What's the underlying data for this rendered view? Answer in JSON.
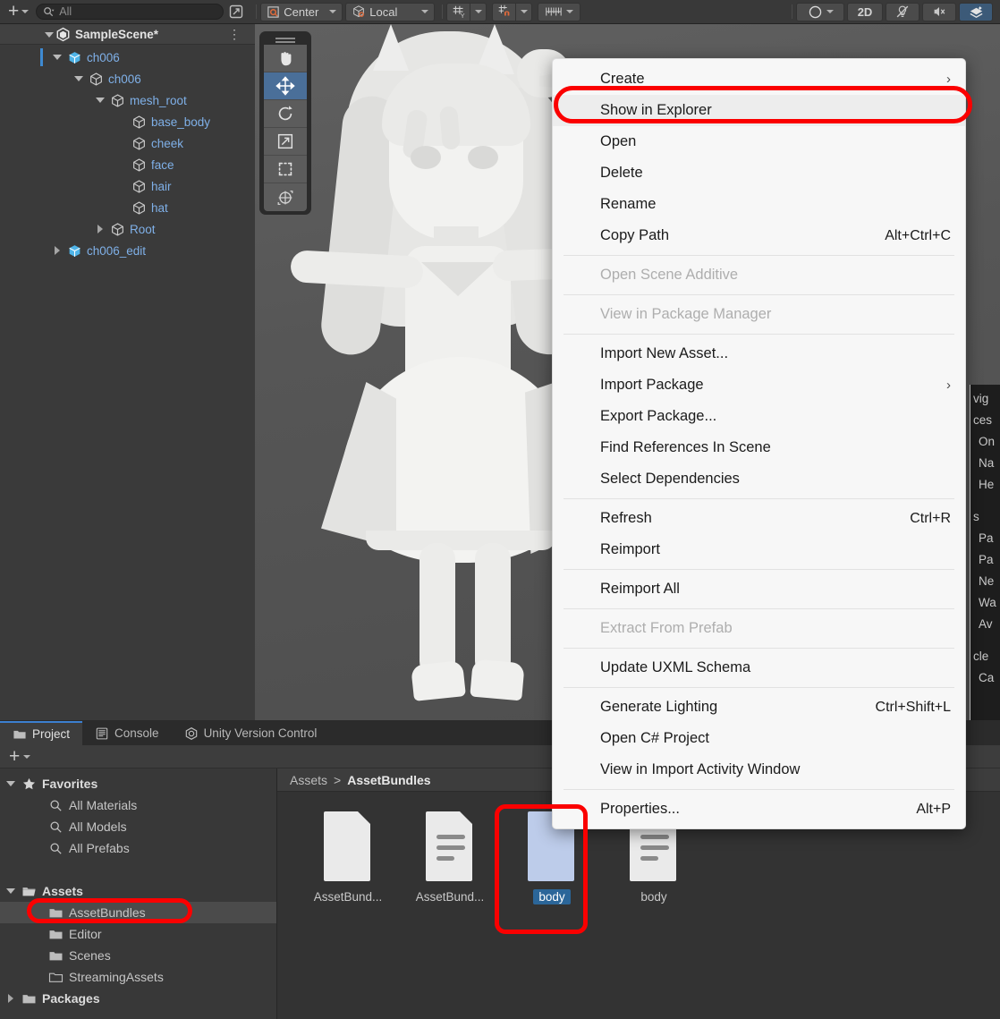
{
  "app": "Unity Editor",
  "toolbar": {
    "add_label": "+",
    "search_placeholder": "All",
    "search_value": "",
    "pivot_mode": "Center",
    "handle_space": "Local",
    "grid_axis": "Y",
    "snap_label": "snap",
    "ruler_label": "ruler",
    "shading_label": "shading",
    "mode_2d": "2D",
    "lighting_label": "lighting-off",
    "audio_label": "audio-off",
    "fx_label": "effects"
  },
  "hierarchy": {
    "scene_name": "SampleScene*",
    "items": [
      {
        "label": "ch006",
        "depth": 1,
        "expanded": true,
        "icon": "prefab",
        "selected": true
      },
      {
        "label": "ch006",
        "depth": 2,
        "expanded": true,
        "icon": "gameobject"
      },
      {
        "label": "mesh_root",
        "depth": 3,
        "expanded": true,
        "icon": "gameobject"
      },
      {
        "label": "base_body",
        "depth": 4,
        "expanded": null,
        "icon": "gameobject"
      },
      {
        "label": "cheek",
        "depth": 4,
        "expanded": null,
        "icon": "gameobject"
      },
      {
        "label": "face",
        "depth": 4,
        "expanded": null,
        "icon": "gameobject"
      },
      {
        "label": "hair",
        "depth": 4,
        "expanded": null,
        "icon": "gameobject"
      },
      {
        "label": "hat",
        "depth": 4,
        "expanded": null,
        "icon": "gameobject"
      },
      {
        "label": "Root",
        "depth": 3,
        "expanded": false,
        "icon": "gameobject"
      },
      {
        "label": "ch006_edit",
        "depth": 1,
        "expanded": false,
        "icon": "prefab"
      }
    ]
  },
  "scene_tools": [
    {
      "name": "hand-tool",
      "selected": false
    },
    {
      "name": "move-tool",
      "selected": true
    },
    {
      "name": "rotate-tool",
      "selected": false
    },
    {
      "name": "scale-tool",
      "selected": false
    },
    {
      "name": "rect-tool",
      "selected": false
    },
    {
      "name": "transform-tool",
      "selected": false
    }
  ],
  "context_menu": {
    "items": [
      {
        "label": "Create",
        "shortcut": "",
        "submenu": true,
        "disabled": false,
        "highlighted": false
      },
      {
        "label": "Show in Explorer",
        "shortcut": "",
        "submenu": false,
        "disabled": false,
        "highlighted": true
      },
      {
        "label": "Open",
        "shortcut": "",
        "submenu": false,
        "disabled": false,
        "highlighted": false
      },
      {
        "label": "Delete",
        "shortcut": "",
        "submenu": false,
        "disabled": false,
        "highlighted": false
      },
      {
        "label": "Rename",
        "shortcut": "",
        "submenu": false,
        "disabled": false,
        "highlighted": false
      },
      {
        "label": "Copy Path",
        "shortcut": "Alt+Ctrl+C",
        "submenu": false,
        "disabled": false,
        "highlighted": false
      },
      {
        "separator": true
      },
      {
        "label": "Open Scene Additive",
        "shortcut": "",
        "submenu": false,
        "disabled": true,
        "highlighted": false
      },
      {
        "separator": true
      },
      {
        "label": "View in Package Manager",
        "shortcut": "",
        "submenu": false,
        "disabled": true,
        "highlighted": false
      },
      {
        "separator": true
      },
      {
        "label": "Import New Asset...",
        "shortcut": "",
        "submenu": false,
        "disabled": false,
        "highlighted": false
      },
      {
        "label": "Import Package",
        "shortcut": "",
        "submenu": true,
        "disabled": false,
        "highlighted": false
      },
      {
        "label": "Export Package...",
        "shortcut": "",
        "submenu": false,
        "disabled": false,
        "highlighted": false
      },
      {
        "label": "Find References In Scene",
        "shortcut": "",
        "submenu": false,
        "disabled": false,
        "highlighted": false
      },
      {
        "label": "Select Dependencies",
        "shortcut": "",
        "submenu": false,
        "disabled": false,
        "highlighted": false
      },
      {
        "separator": true
      },
      {
        "label": "Refresh",
        "shortcut": "Ctrl+R",
        "submenu": false,
        "disabled": false,
        "highlighted": false
      },
      {
        "label": "Reimport",
        "shortcut": "",
        "submenu": false,
        "disabled": false,
        "highlighted": false
      },
      {
        "separator": true
      },
      {
        "label": "Reimport All",
        "shortcut": "",
        "submenu": false,
        "disabled": false,
        "highlighted": false
      },
      {
        "separator": true
      },
      {
        "label": "Extract From Prefab",
        "shortcut": "",
        "submenu": false,
        "disabled": true,
        "highlighted": false
      },
      {
        "separator": true
      },
      {
        "label": "Update UXML Schema",
        "shortcut": "",
        "submenu": false,
        "disabled": false,
        "highlighted": false
      },
      {
        "separator": true
      },
      {
        "label": "Generate Lighting",
        "shortcut": "Ctrl+Shift+L",
        "submenu": false,
        "disabled": false,
        "highlighted": false
      },
      {
        "label": "Open C# Project",
        "shortcut": "",
        "submenu": false,
        "disabled": false,
        "highlighted": false
      },
      {
        "label": "View in Import Activity Window",
        "shortcut": "",
        "submenu": false,
        "disabled": false,
        "highlighted": false
      },
      {
        "separator": true
      },
      {
        "label": "Properties...",
        "shortcut": "Alt+P",
        "submenu": false,
        "disabled": false,
        "highlighted": false
      }
    ]
  },
  "right_panel": {
    "rows": [
      "vig",
      "ces",
      "On",
      "Na",
      "He",
      "",
      "s",
      "Pa",
      "Pa",
      "Ne",
      "Wa",
      "Av",
      "",
      "cle",
      "Ca"
    ]
  },
  "bottom_panel": {
    "tabs": [
      {
        "label": "Project",
        "icon": "folder-icon",
        "active": true
      },
      {
        "label": "Console",
        "icon": "console-icon",
        "active": false
      },
      {
        "label": "Unity Version Control",
        "icon": "version-control-icon",
        "active": false
      }
    ],
    "add_label": "+",
    "tree": [
      {
        "label": "Favorites",
        "depth": 0,
        "icon": "star-icon",
        "bold": true,
        "expanded": true
      },
      {
        "label": "All Materials",
        "depth": 1,
        "icon": "search-icon",
        "bold": false
      },
      {
        "label": "All Models",
        "depth": 1,
        "icon": "search-icon",
        "bold": false
      },
      {
        "label": "All Prefabs",
        "depth": 1,
        "icon": "search-icon",
        "bold": false
      },
      {
        "label": "",
        "depth": 0,
        "icon": "spacer",
        "bold": false
      },
      {
        "label": "Assets",
        "depth": 0,
        "icon": "folder-open-icon",
        "bold": true,
        "expanded": true
      },
      {
        "label": "AssetBundles",
        "depth": 1,
        "icon": "folder-icon",
        "bold": false,
        "highlighted": true
      },
      {
        "label": "Editor",
        "depth": 1,
        "icon": "folder-icon",
        "bold": false
      },
      {
        "label": "Scenes",
        "depth": 1,
        "icon": "folder-icon",
        "bold": false
      },
      {
        "label": "StreamingAssets",
        "depth": 1,
        "icon": "folder-empty-icon",
        "bold": false
      },
      {
        "label": "Packages",
        "depth": 0,
        "icon": "folder-icon",
        "bold": true,
        "expanded": false
      }
    ],
    "breadcrumb": {
      "root": "Assets",
      "separator": ">",
      "current": "AssetBundles"
    },
    "assets": [
      {
        "label": "AssetBund...",
        "icon": "file-blank-icon",
        "selected": false
      },
      {
        "label": "AssetBund...",
        "icon": "file-text-icon",
        "selected": false
      },
      {
        "label": "body",
        "icon": "file-blue-icon",
        "selected": true
      },
      {
        "label": "body",
        "icon": "file-text-icon",
        "selected": false
      }
    ]
  },
  "annotations": {
    "color": "#fb0000",
    "targets": [
      "Show in Explorer menu item",
      "AssetBundles folder row",
      "body asset thumbnail"
    ]
  }
}
